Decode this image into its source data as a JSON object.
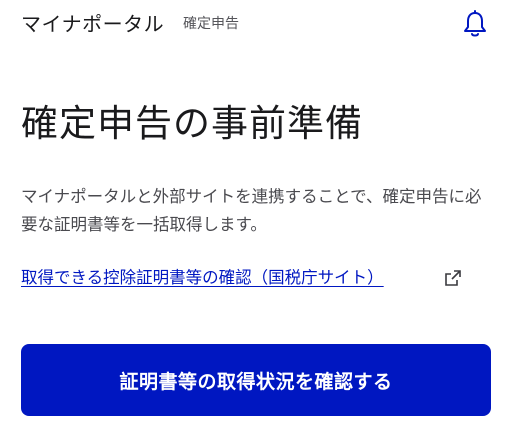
{
  "header": {
    "app_title": "マイナポータル",
    "app_subtitle": "確定申告",
    "notification_icon": "bell-icon"
  },
  "main": {
    "title": "確定申告の事前準備",
    "description": "マイナポータルと外部サイトを連携することで、確定申告に必要な証明書等を一括取得します。",
    "link_text": "取得できる控除証明書等の確認（国税庁サイト）",
    "link_icon": "external-link-icon",
    "button_label": "証明書等の取得状況を確認する"
  },
  "colors": {
    "primary": "#0017c1",
    "text": "#1a1a1c",
    "muted_text": "#4a4a4f"
  }
}
